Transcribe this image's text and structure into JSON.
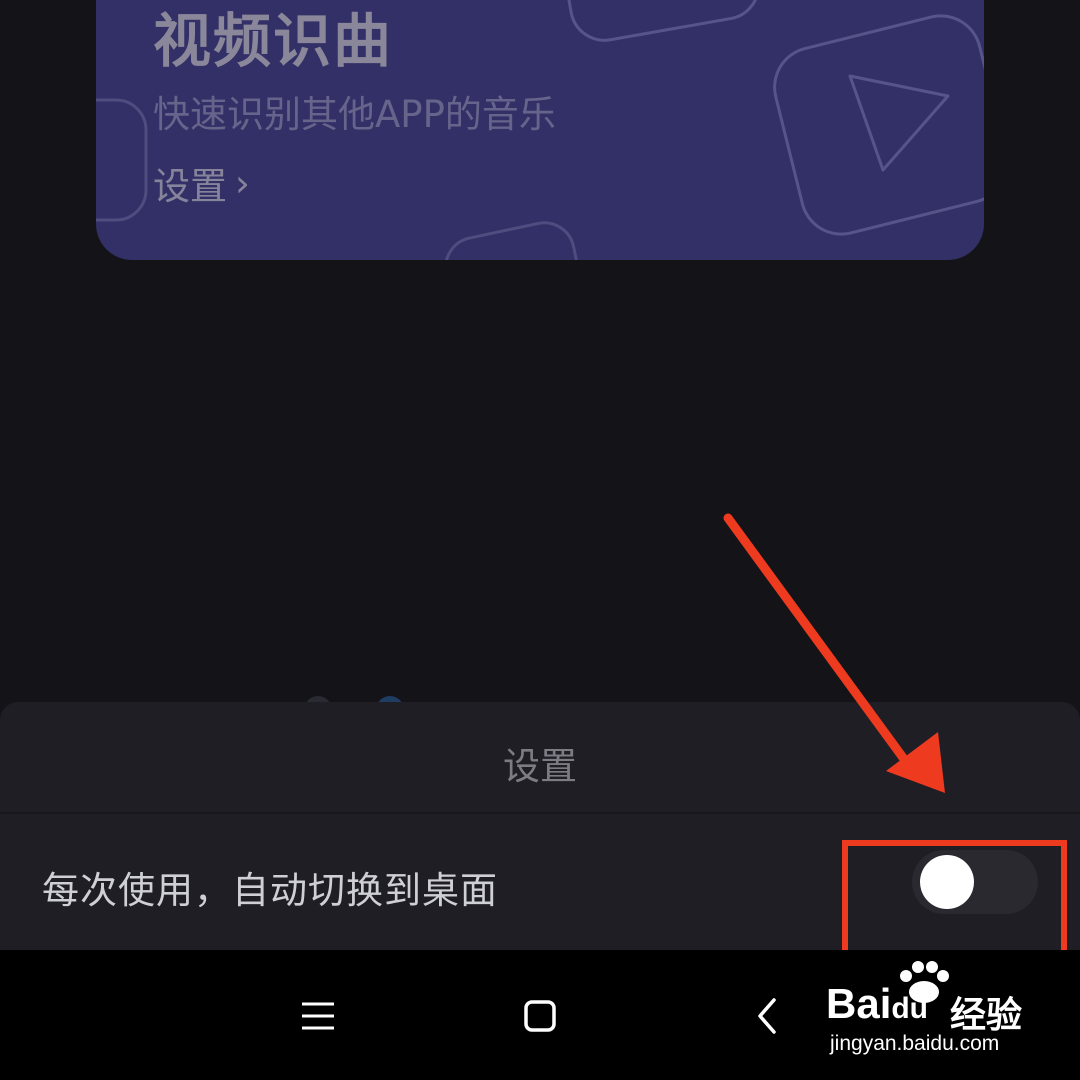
{
  "card": {
    "title": "视频识曲",
    "subtitle": "快速识别其他APP的音乐",
    "link_label": "设置",
    "link_chevron": "›"
  },
  "sheet": {
    "title": "设置",
    "row_label": "每次使用，自动切换到桌面",
    "toggle_on": false
  },
  "navbar": {
    "icons": [
      "menu-icon",
      "home-square-icon",
      "back-icon"
    ]
  },
  "watermark": {
    "logo": "Bai",
    "logo_du": "du",
    "cn": "经验",
    "url": "jingyan.baidu.com"
  },
  "colors": {
    "card_bg": "#333067",
    "sheet_bg": "#1f1e24",
    "annotation": "#ee3a1f",
    "toggle_track": "#2a2930"
  }
}
